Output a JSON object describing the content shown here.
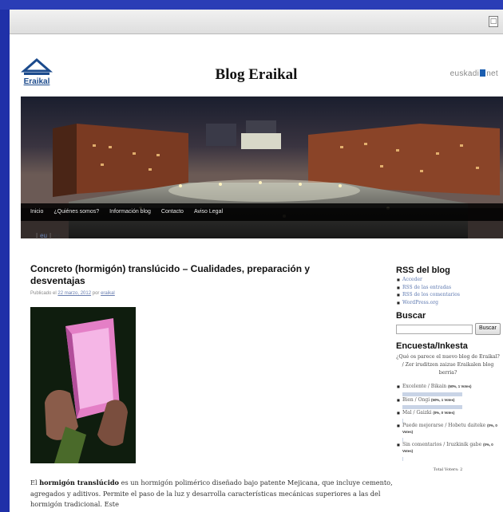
{
  "browser": {
    "toolbar_icon": "page-icon"
  },
  "header": {
    "logo_text": "Eraikal",
    "site_title": "Blog Eraikal",
    "partner_left": "euskadi",
    "partner_right": "net"
  },
  "nav": {
    "items": [
      "Inicio",
      "¿Quiénes somos?",
      "Información blog",
      "Contacto",
      "Aviso Legal"
    ]
  },
  "lang": {
    "current": "es",
    "other": "eu"
  },
  "post": {
    "title": "Concreto (hormigón) translúcido – Cualidades, preparación y desventajas",
    "meta_prefix": "Publicado el",
    "date": "22 marzo, 2012",
    "meta_by": "por",
    "author": "eraikal",
    "body_intro": "El ",
    "body_bold": "hormigón translúcido",
    "body_rest": " es un hormigón polimérico diseñado bajo patente Mejicana, que incluye cemento, agregados y aditivos. Permite el paso de la luz y desarrolla características mecánicas superiores a las del hormigón tradicional. Este"
  },
  "sidebar": {
    "rss_title": "RSS del blog",
    "rss_links": [
      "Acceder",
      "RSS de las entradas",
      "RSS de los comentarios",
      "WordPress.org"
    ],
    "search_title": "Buscar",
    "search_button": "Buscar",
    "search_value": "",
    "poll_title": "Encuesta/Inkesta",
    "poll_question": "¿Qué os parece el nuevo blog de Eraikal? / Zer iruditzen zaizue Eraikalen blog berria?",
    "poll_options": [
      {
        "label": "Excelente / Bikain",
        "votes": "(50%, 1 Votes)",
        "share": 0.5
      },
      {
        "label": "Bien / Ongi",
        "votes": "(50%, 1 Votes)",
        "share": 0.5
      },
      {
        "label": "Mal / Gaizki",
        "votes": "(0%, 0 Votes)",
        "share": 0
      },
      {
        "label": "Puede mejorarse / Hobetu daiteke",
        "votes": "(0%, 0 Votes)",
        "share": 0
      },
      {
        "label": "Sin comentarios / Iruzkinik gabe",
        "votes": "(0%, 0 Votes)",
        "share": 0
      }
    ],
    "poll_footer": "Total Voters: 2"
  },
  "colors": {
    "frame": "#1f30a8",
    "link": "#5d78b0",
    "logo": "#1b4a8c"
  }
}
